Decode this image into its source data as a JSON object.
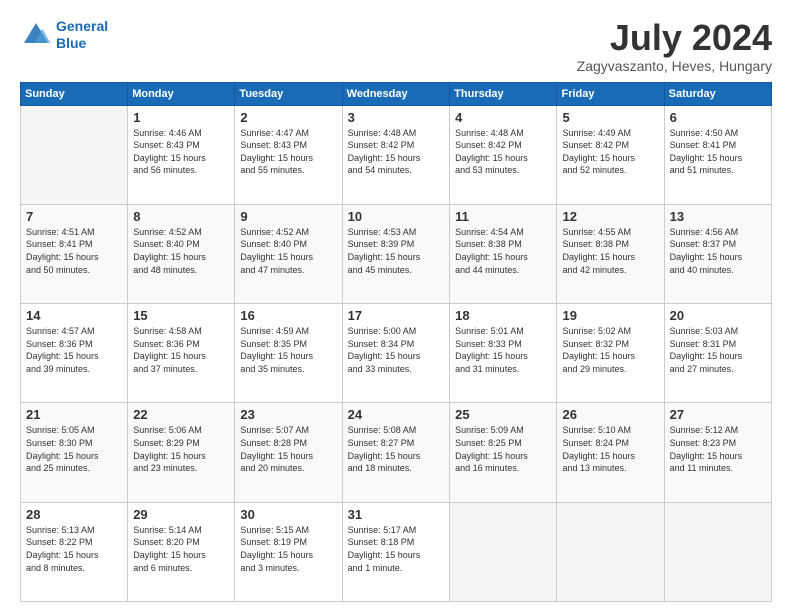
{
  "header": {
    "logo_line1": "General",
    "logo_line2": "Blue",
    "title": "July 2024",
    "subtitle": "Zagyvaszanto, Heves, Hungary"
  },
  "days_of_week": [
    "Sunday",
    "Monday",
    "Tuesday",
    "Wednesday",
    "Thursday",
    "Friday",
    "Saturday"
  ],
  "weeks": [
    [
      {
        "day": "",
        "info": ""
      },
      {
        "day": "1",
        "info": "Sunrise: 4:46 AM\nSunset: 8:43 PM\nDaylight: 15 hours\nand 56 minutes."
      },
      {
        "day": "2",
        "info": "Sunrise: 4:47 AM\nSunset: 8:43 PM\nDaylight: 15 hours\nand 55 minutes."
      },
      {
        "day": "3",
        "info": "Sunrise: 4:48 AM\nSunset: 8:42 PM\nDaylight: 15 hours\nand 54 minutes."
      },
      {
        "day": "4",
        "info": "Sunrise: 4:48 AM\nSunset: 8:42 PM\nDaylight: 15 hours\nand 53 minutes."
      },
      {
        "day": "5",
        "info": "Sunrise: 4:49 AM\nSunset: 8:42 PM\nDaylight: 15 hours\nand 52 minutes."
      },
      {
        "day": "6",
        "info": "Sunrise: 4:50 AM\nSunset: 8:41 PM\nDaylight: 15 hours\nand 51 minutes."
      }
    ],
    [
      {
        "day": "7",
        "info": "Sunrise: 4:51 AM\nSunset: 8:41 PM\nDaylight: 15 hours\nand 50 minutes."
      },
      {
        "day": "8",
        "info": "Sunrise: 4:52 AM\nSunset: 8:40 PM\nDaylight: 15 hours\nand 48 minutes."
      },
      {
        "day": "9",
        "info": "Sunrise: 4:52 AM\nSunset: 8:40 PM\nDaylight: 15 hours\nand 47 minutes."
      },
      {
        "day": "10",
        "info": "Sunrise: 4:53 AM\nSunset: 8:39 PM\nDaylight: 15 hours\nand 45 minutes."
      },
      {
        "day": "11",
        "info": "Sunrise: 4:54 AM\nSunset: 8:38 PM\nDaylight: 15 hours\nand 44 minutes."
      },
      {
        "day": "12",
        "info": "Sunrise: 4:55 AM\nSunset: 8:38 PM\nDaylight: 15 hours\nand 42 minutes."
      },
      {
        "day": "13",
        "info": "Sunrise: 4:56 AM\nSunset: 8:37 PM\nDaylight: 15 hours\nand 40 minutes."
      }
    ],
    [
      {
        "day": "14",
        "info": "Sunrise: 4:57 AM\nSunset: 8:36 PM\nDaylight: 15 hours\nand 39 minutes."
      },
      {
        "day": "15",
        "info": "Sunrise: 4:58 AM\nSunset: 8:36 PM\nDaylight: 15 hours\nand 37 minutes."
      },
      {
        "day": "16",
        "info": "Sunrise: 4:59 AM\nSunset: 8:35 PM\nDaylight: 15 hours\nand 35 minutes."
      },
      {
        "day": "17",
        "info": "Sunrise: 5:00 AM\nSunset: 8:34 PM\nDaylight: 15 hours\nand 33 minutes."
      },
      {
        "day": "18",
        "info": "Sunrise: 5:01 AM\nSunset: 8:33 PM\nDaylight: 15 hours\nand 31 minutes."
      },
      {
        "day": "19",
        "info": "Sunrise: 5:02 AM\nSunset: 8:32 PM\nDaylight: 15 hours\nand 29 minutes."
      },
      {
        "day": "20",
        "info": "Sunrise: 5:03 AM\nSunset: 8:31 PM\nDaylight: 15 hours\nand 27 minutes."
      }
    ],
    [
      {
        "day": "21",
        "info": "Sunrise: 5:05 AM\nSunset: 8:30 PM\nDaylight: 15 hours\nand 25 minutes."
      },
      {
        "day": "22",
        "info": "Sunrise: 5:06 AM\nSunset: 8:29 PM\nDaylight: 15 hours\nand 23 minutes."
      },
      {
        "day": "23",
        "info": "Sunrise: 5:07 AM\nSunset: 8:28 PM\nDaylight: 15 hours\nand 20 minutes."
      },
      {
        "day": "24",
        "info": "Sunrise: 5:08 AM\nSunset: 8:27 PM\nDaylight: 15 hours\nand 18 minutes."
      },
      {
        "day": "25",
        "info": "Sunrise: 5:09 AM\nSunset: 8:25 PM\nDaylight: 15 hours\nand 16 minutes."
      },
      {
        "day": "26",
        "info": "Sunrise: 5:10 AM\nSunset: 8:24 PM\nDaylight: 15 hours\nand 13 minutes."
      },
      {
        "day": "27",
        "info": "Sunrise: 5:12 AM\nSunset: 8:23 PM\nDaylight: 15 hours\nand 11 minutes."
      }
    ],
    [
      {
        "day": "28",
        "info": "Sunrise: 5:13 AM\nSunset: 8:22 PM\nDaylight: 15 hours\nand 8 minutes."
      },
      {
        "day": "29",
        "info": "Sunrise: 5:14 AM\nSunset: 8:20 PM\nDaylight: 15 hours\nand 6 minutes."
      },
      {
        "day": "30",
        "info": "Sunrise: 5:15 AM\nSunset: 8:19 PM\nDaylight: 15 hours\nand 3 minutes."
      },
      {
        "day": "31",
        "info": "Sunrise: 5:17 AM\nSunset: 8:18 PM\nDaylight: 15 hours\nand 1 minute."
      },
      {
        "day": "",
        "info": ""
      },
      {
        "day": "",
        "info": ""
      },
      {
        "day": "",
        "info": ""
      }
    ]
  ]
}
